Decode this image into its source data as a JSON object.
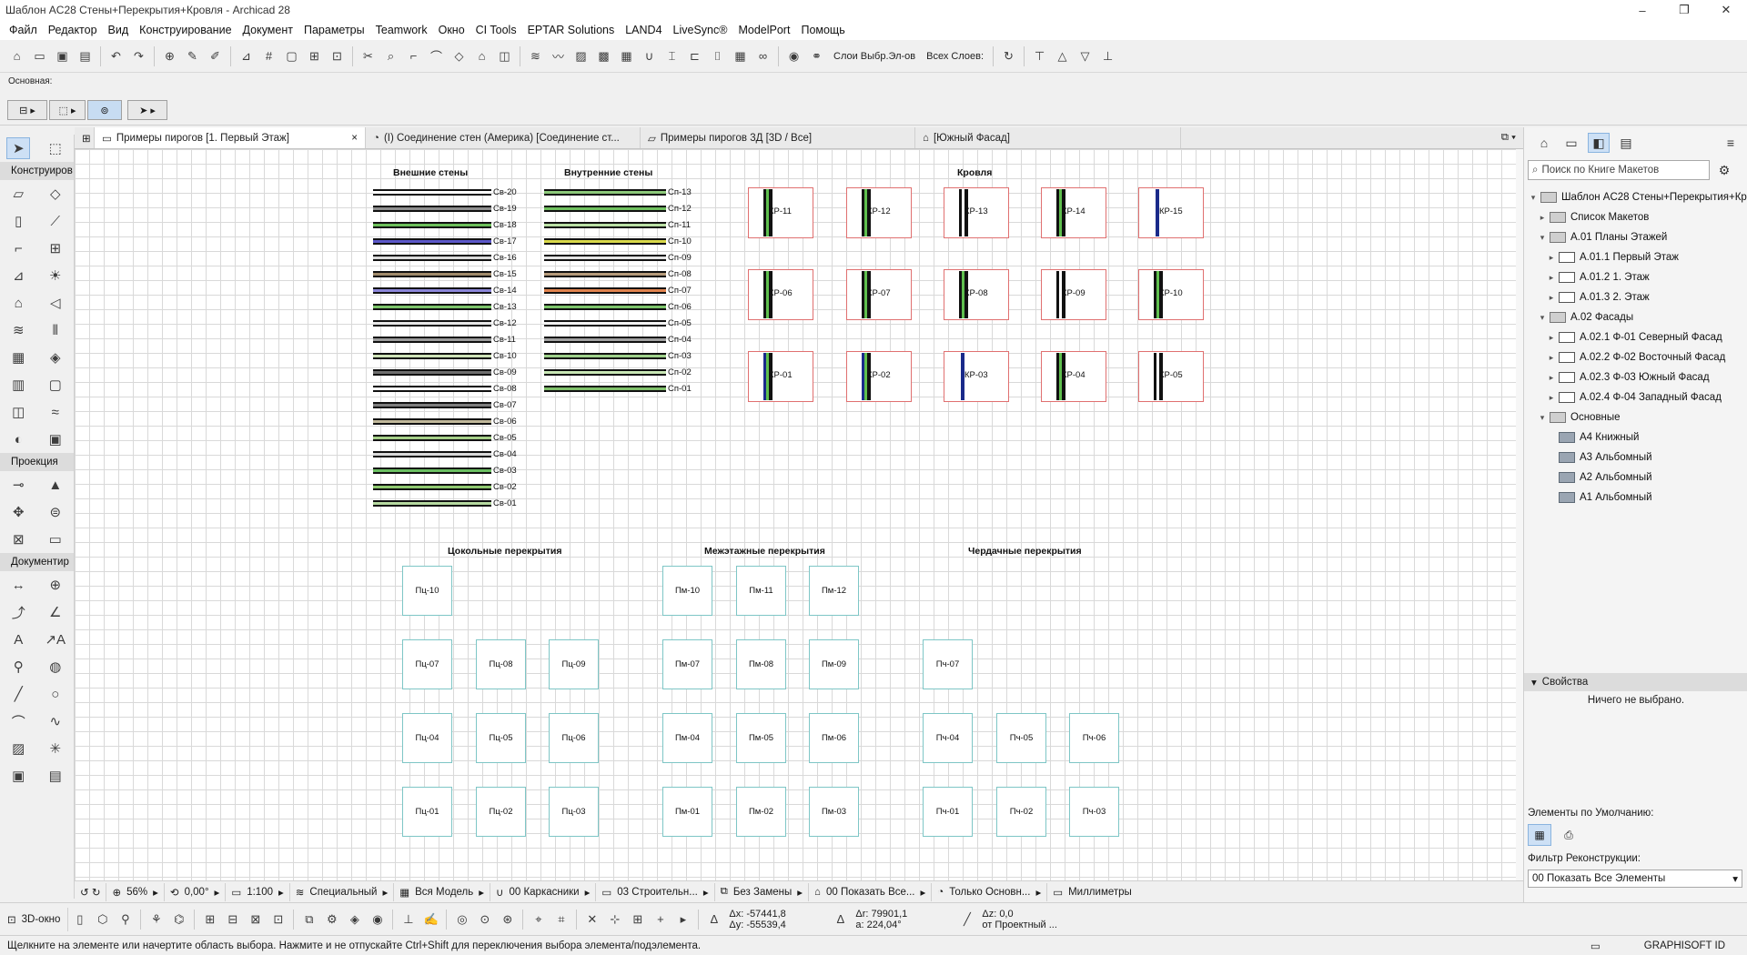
{
  "window": {
    "title": "Шаблон AC28 Стены+Перекрытия+Кровля - Archicad 28",
    "minimize": "–",
    "maximize": "❐",
    "close": "✕"
  },
  "menu": [
    "Файл",
    "Редактор",
    "Вид",
    "Конструирование",
    "Документ",
    "Параметры",
    "Teamwork",
    "Окно",
    "CI Tools",
    "EPTAR Solutions",
    "LAND4",
    "LiveSync®",
    "ModelPort",
    "Помощь"
  ],
  "toolbar": {
    "layers_label1": "Слои Выбр.Эл-ов",
    "layers_label2": "Всех Слоев:"
  },
  "infobox": {
    "label": "Основная:"
  },
  "toolbox": {
    "section_design": "Конструиров",
    "section_projection": "Проекция",
    "section_document": "Документир"
  },
  "tabs": [
    {
      "label": "Примеры пирогов [1. Первый Этаж]",
      "close": "×"
    },
    {
      "label": "(I) Соединение стен (Америка) [Соединение ст..."
    },
    {
      "label": "Примеры пирогов 3Д [3D / Все]"
    },
    {
      "label": "[Южный Фасад]"
    }
  ],
  "drawing": {
    "walls_ext_title": "Внешние стены",
    "walls_int_title": "Внутренние стены",
    "roof_title": "Кровля",
    "slab_base_title": "Цокольные перекрытия",
    "slab_inter_title": "Межэтажные перекрытия",
    "slab_attic_title": "Чердачные перекрытия",
    "walls_ext": [
      "Св-20",
      "Св-19",
      "Св-18",
      "Св-17",
      "Св-16",
      "Св-15",
      "Св-14",
      "Св-13",
      "Св-12",
      "Св-11",
      "Св-10",
      "Св-09",
      "Св-08",
      "Св-07",
      "Св-06",
      "Св-05",
      "Св-04",
      "Св-03",
      "Св-02",
      "Св-01"
    ],
    "walls_int": [
      "Сп-13",
      "Сп-12",
      "Сп-11",
      "Сп-10",
      "Сп-09",
      "Сп-08",
      "Сп-07",
      "Сп-06",
      "Сп-05",
      "Сп-04",
      "Сп-03",
      "Сп-02",
      "Сп-01"
    ],
    "roofs_row1": [
      "КР-11",
      "КР-12",
      "КР-13",
      "КР-14",
      "КР-15"
    ],
    "roofs_row2": [
      "КР-06",
      "КР-07",
      "КР-08",
      "КР-09",
      "КР-10"
    ],
    "roofs_row3": [
      "КР-01",
      "КР-02",
      "КР-03",
      "КР-04",
      "КР-05"
    ],
    "slabs_base": [
      "Пц-10",
      "Пц-07",
      "Пц-08",
      "Пц-09",
      "Пц-04",
      "Пц-05",
      "Пц-06",
      "Пц-01",
      "Пц-02",
      "Пц-03"
    ],
    "slabs_inter": [
      "Пм-10",
      "Пм-11",
      "Пм-12",
      "Пм-07",
      "Пм-08",
      "Пм-09",
      "Пм-04",
      "Пм-05",
      "Пм-06",
      "Пм-01",
      "Пм-02",
      "Пм-03"
    ],
    "slabs_attic": [
      "Пч-07",
      "Пч-04",
      "Пч-05",
      "Пч-06",
      "Пч-01",
      "Пч-02",
      "Пч-03"
    ]
  },
  "navigator": {
    "search_placeholder": "Поиск по Книге Макетов",
    "tree": [
      {
        "label": "Шаблон AC28 Стены+Перекрытия+Кр",
        "level": 0,
        "arrow": "v",
        "icon": "folder"
      },
      {
        "label": "Список Макетов",
        "level": 1,
        "arrow": ">",
        "icon": "folder"
      },
      {
        "label": "A.01 Планы Этажей",
        "level": 1,
        "arrow": "v",
        "icon": "folder"
      },
      {
        "label": "A.01.1 Первый Этаж",
        "level": 2,
        "arrow": ">",
        "icon": "page"
      },
      {
        "label": "A.01.2 1. Этаж",
        "level": 2,
        "arrow": ">",
        "icon": "page"
      },
      {
        "label": "A.01.3 2. Этаж",
        "level": 2,
        "arrow": ">",
        "icon": "page"
      },
      {
        "label": "A.02 Фасады",
        "level": 1,
        "arrow": "v",
        "icon": "folder"
      },
      {
        "label": "A.02.1 Ф-01 Северный Фасад",
        "level": 2,
        "arrow": ">",
        "icon": "page"
      },
      {
        "label": "A.02.2 Ф-02 Восточный Фасад",
        "level": 2,
        "arrow": ">",
        "icon": "page"
      },
      {
        "label": "A.02.3 Ф-03 Южный Фасад",
        "level": 2,
        "arrow": ">",
        "icon": "page"
      },
      {
        "label": "A.02.4 Ф-04 Западный Фасад",
        "level": 2,
        "arrow": ">",
        "icon": "page"
      },
      {
        "label": "Основные",
        "level": 1,
        "arrow": "v",
        "icon": "folder"
      },
      {
        "label": "A4 Книжный",
        "level": 2,
        "arrow": "",
        "icon": "layout"
      },
      {
        "label": "A3 Альбомный",
        "level": 2,
        "arrow": "",
        "icon": "layout"
      },
      {
        "label": "A2 Альбомный",
        "level": 2,
        "arrow": "",
        "icon": "layout"
      },
      {
        "label": "A1 Альбомный",
        "level": 2,
        "arrow": "",
        "icon": "layout"
      }
    ],
    "props_title": "Свойства",
    "props_empty": "Ничего не выбрано.",
    "defaults_label": "Элементы по Умолчанию:",
    "filter_label": "Фильтр Реконструкции:",
    "filter_value": "00 Показать Все Элементы"
  },
  "status_row": {
    "zoom": "56%",
    "angle": "0,00°",
    "scale": "1:100",
    "structure": "Специальный",
    "model": "Вся Модель",
    "pen": "00 Каркасники",
    "layer": "03 Строительн...",
    "override": "Без Замены",
    "renovation": "00 Показать Все...",
    "mvo": "Только Основн...",
    "units": "Миллиметры"
  },
  "bottom": {
    "view3d": "3D-окно",
    "dx": "Δx: -57441,8",
    "dy": "Δy: -55539,4",
    "dr": "Δr: 79901,1",
    "da": "a: 224,04°",
    "dz": "Δz: 0,0",
    "ref": "от Проектный ..."
  },
  "statusbar": {
    "message": "Щелкните на элементе или начертите область выбора. Нажмите и не отпускайте Ctrl+Shift для переключения выбора элемента/подэлемента.",
    "graphisoft": "GRAPHISOFT ID"
  }
}
